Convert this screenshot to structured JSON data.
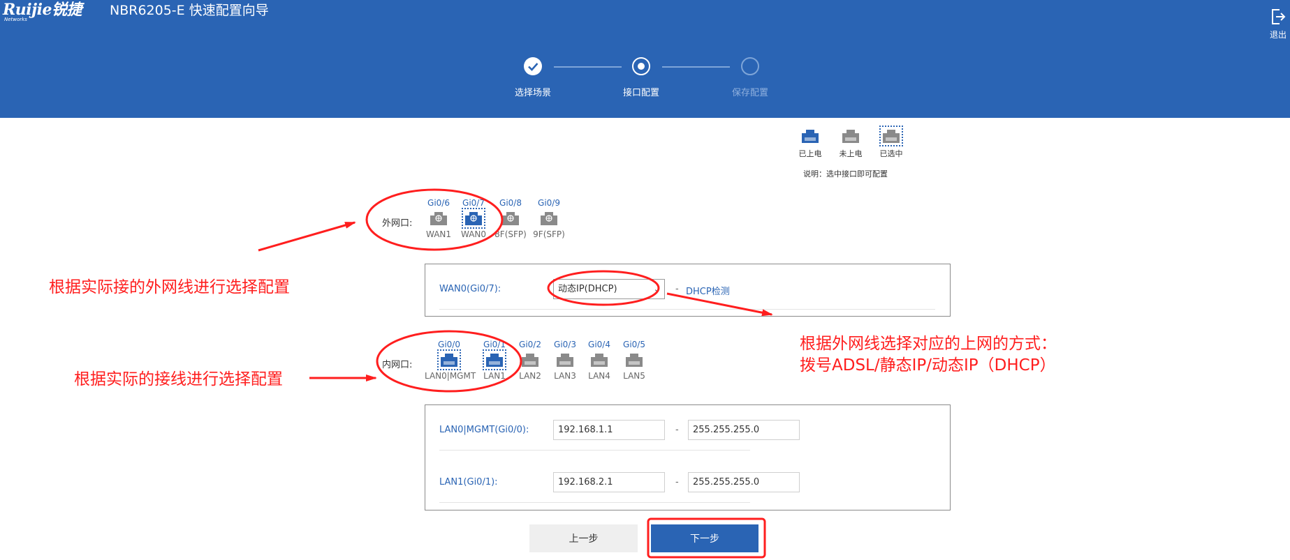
{
  "header": {
    "logo_text": "Ruijie锐捷",
    "logo_sub": "Networks",
    "title": "NBR6205-E  快速配置向导",
    "logout_label": "退出"
  },
  "stepper": {
    "steps": [
      {
        "label": "选择场景",
        "state": "done"
      },
      {
        "label": "接口配置",
        "state": "current"
      },
      {
        "label": "保存配置",
        "state": "pending"
      }
    ]
  },
  "legend": {
    "items": [
      {
        "label": "已上电",
        "state": "powered"
      },
      {
        "label": "未上电",
        "state": "unpowered"
      },
      {
        "label": "已选中",
        "state": "selected"
      }
    ],
    "note": "说明：选中接口即可配置"
  },
  "wan_row": {
    "label": "外网口:",
    "ports": [
      {
        "gi": "Gi0/6",
        "name": "WAN1",
        "state": "unpowered",
        "selected": false
      },
      {
        "gi": "Gi0/7",
        "name": "WAN0",
        "state": "powered",
        "selected": true
      },
      {
        "gi": "Gi0/8",
        "name": "8F(SFP)",
        "state": "unpowered",
        "selected": false
      },
      {
        "gi": "Gi0/9",
        "name": "9F(SFP)",
        "state": "unpowered",
        "selected": false
      }
    ]
  },
  "wan_panel": {
    "label": "WAN0(Gi0/7):",
    "mode_value": "动态IP(DHCP)",
    "dash": "-",
    "detect_link": "DHCP检测"
  },
  "lan_row": {
    "label": "内网口:",
    "ports": [
      {
        "gi": "Gi0/0",
        "name": "LAN0|MGMT",
        "state": "powered",
        "selected": true
      },
      {
        "gi": "Gi0/1",
        "name": "LAN1",
        "state": "powered",
        "selected": true
      },
      {
        "gi": "Gi0/2",
        "name": "LAN2",
        "state": "unpowered",
        "selected": false
      },
      {
        "gi": "Gi0/3",
        "name": "LAN3",
        "state": "unpowered",
        "selected": false
      },
      {
        "gi": "Gi0/4",
        "name": "LAN4",
        "state": "unpowered",
        "selected": false
      },
      {
        "gi": "Gi0/5",
        "name": "LAN5",
        "state": "unpowered",
        "selected": false
      }
    ]
  },
  "lan_panel": {
    "rows": [
      {
        "label": "LAN0|MGMT(Gi0/0):",
        "ip": "192.168.1.1",
        "dash": "-",
        "mask": "255.255.255.0"
      },
      {
        "label": "LAN1(Gi0/1):",
        "ip": "192.168.2.1",
        "dash": "-",
        "mask": "255.255.255.0"
      }
    ]
  },
  "buttons": {
    "prev_label": "上一步",
    "next_label": "下一步"
  },
  "annotations": {
    "wan_note": "根据实际接的外网线进行选择配置",
    "lan_note": "根据实际的接线进行选择配置",
    "mode_note_line1": "根据外网线选择对应的上网的方式：",
    "mode_note_line2": "拨号ADSL/静态IP/动态IP（DHCP）"
  },
  "colors": {
    "header_bg": "#2a64b4",
    "port_powered": "#2a64b4",
    "port_unpowered": "#8a8a8a",
    "annotation_red": "#ff1e1e"
  }
}
